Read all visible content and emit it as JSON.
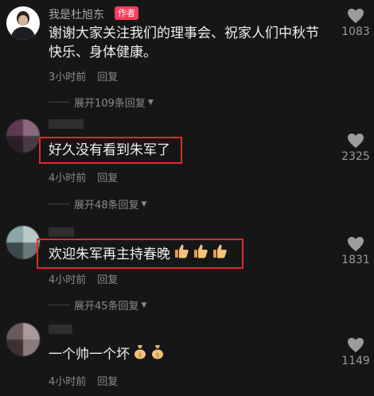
{
  "comments": [
    {
      "username": "我是杜旭东",
      "badge": "作者",
      "text_line1": "谢谢大家关注我们的理事会、祝家人们中秋节",
      "text_line2": "快乐、身体健康。",
      "time": "3小时前",
      "reply": "回复",
      "expand": "展开109条回复",
      "likes": "1083"
    },
    {
      "text": "好久没有看到朱军了",
      "time": "4小时前",
      "reply": "回复",
      "expand": "展开48条回复",
      "likes": "2325"
    },
    {
      "text": "欢迎朱军再主持春晚",
      "emojis": [
        "thumbs-up-icon",
        "thumbs-up-icon",
        "thumbs-up-icon"
      ],
      "time": "4小时前",
      "reply": "回复",
      "expand": "展开45条回复",
      "likes": "1831"
    },
    {
      "text": "一个帅一个坏",
      "emojis": [
        "money-bag-icon",
        "money-bag-icon"
      ],
      "time": "4小时前",
      "reply": "回复",
      "likes": "1149"
    }
  ],
  "colors": {
    "background": "#161616",
    "badge": "#ff3b5c",
    "highlight_box": "#e0282e"
  }
}
